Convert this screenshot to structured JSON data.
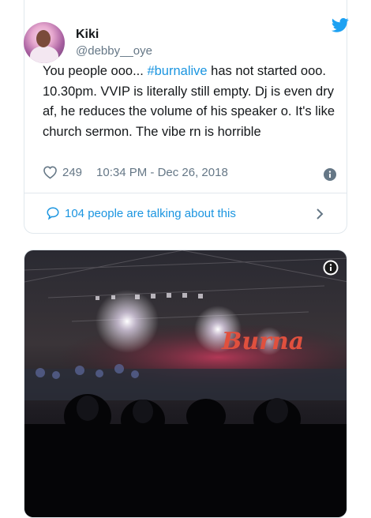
{
  "tweet": {
    "display_name": "Kiki",
    "handle": "@debby__oye",
    "text_before": "You people ooo... ",
    "hashtag": "#burnalive",
    "text_after": " has not started ooo. 10.30pm. VVIP is literally still empty. Dj is even dry af, he reduces the volume of his speaker o. It's like church sermon. The vibe rn is horrible",
    "likes": "249",
    "timestamp": "10:34 PM - Dec 26, 2018",
    "talking": "104 people are talking about this"
  },
  "icons": {
    "brand": "twitter-bird-icon",
    "like": "heart-icon",
    "info": "info-icon",
    "talk": "speech-bubble-icon",
    "chevron": "chevron-right-icon"
  },
  "photo": {
    "banner_text": "Burna"
  },
  "colors": {
    "accent": "#1b95e0",
    "muted": "#657786",
    "border": "#e1e8ed"
  }
}
